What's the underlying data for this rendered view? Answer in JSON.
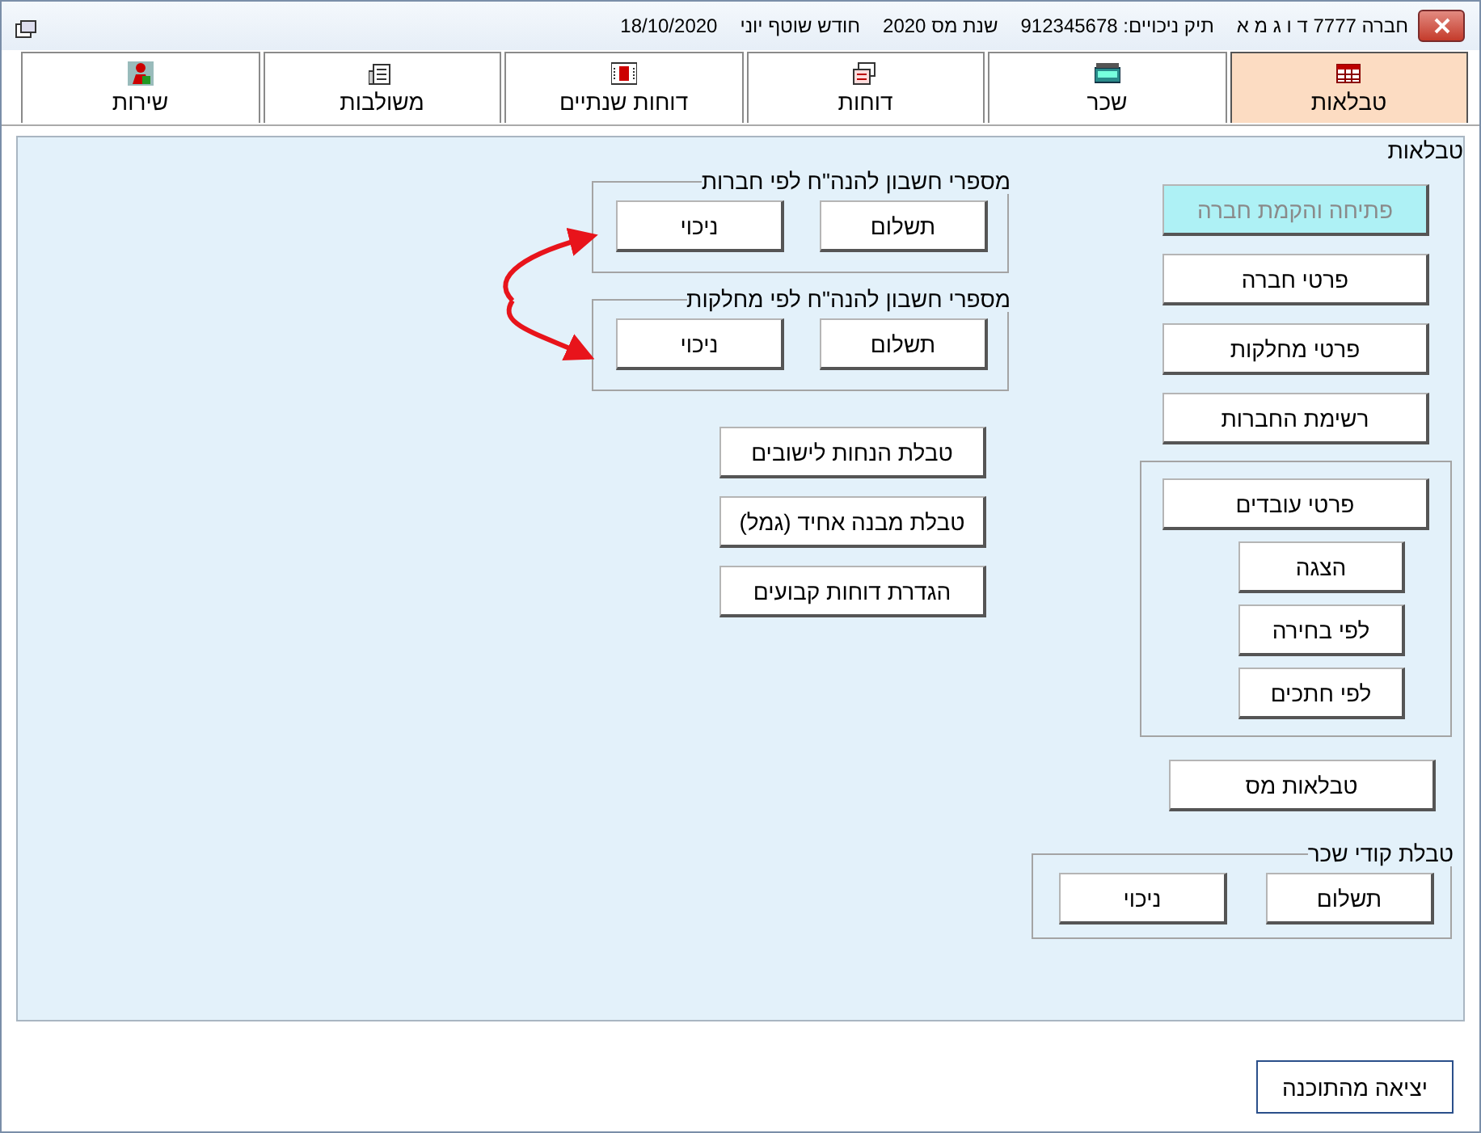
{
  "window": {
    "title_parts": [
      "חברה 7777 ד ו ג מ א",
      "תיק ניכויים: 912345678",
      "שנת מס 2020",
      "חודש שוטף יוני",
      "18/10/2020"
    ]
  },
  "tabs": [
    {
      "label": "טבלאות",
      "selected": true
    },
    {
      "label": "שכר",
      "selected": false
    },
    {
      "label": "דוחות",
      "selected": false
    },
    {
      "label": "דוחות שנתיים",
      "selected": false
    },
    {
      "label": "משולבות",
      "selected": false
    },
    {
      "label": "שירות",
      "selected": false
    }
  ],
  "panel": {
    "title": "טבלאות",
    "main_buttons": [
      {
        "label": "פתיחה והקמת חברה",
        "disabled": true
      },
      {
        "label": "פרטי חברה",
        "disabled": false
      },
      {
        "label": "פרטי מחלקות",
        "disabled": false
      },
      {
        "label": "רשימת החברות",
        "disabled": false
      }
    ],
    "employees_group": {
      "main": "פרטי עובדים",
      "buttons": [
        "הצגה",
        "לפי בחירה",
        "לפי חתכים"
      ]
    },
    "tax_button": "טבלאות מס",
    "pay_codes_group": {
      "title": "טבלת קודי שכר",
      "buttons": [
        "תשלום",
        "ניכוי"
      ]
    },
    "account_groups": [
      {
        "title": "מספרי חשבון להנה\"ח לפי חברות",
        "buttons": [
          "תשלום",
          "ניכוי"
        ]
      },
      {
        "title": "מספרי חשבון להנה\"ח לפי מחלקות",
        "buttons": [
          "תשלום",
          "ניכוי"
        ]
      }
    ],
    "table_buttons": [
      "טבלת הנחות לישובים",
      "טבלת מבנה אחיד (גמל)",
      "הגדרת דוחות קבועים"
    ]
  },
  "exit_button": "יציאה מהתוכנה"
}
